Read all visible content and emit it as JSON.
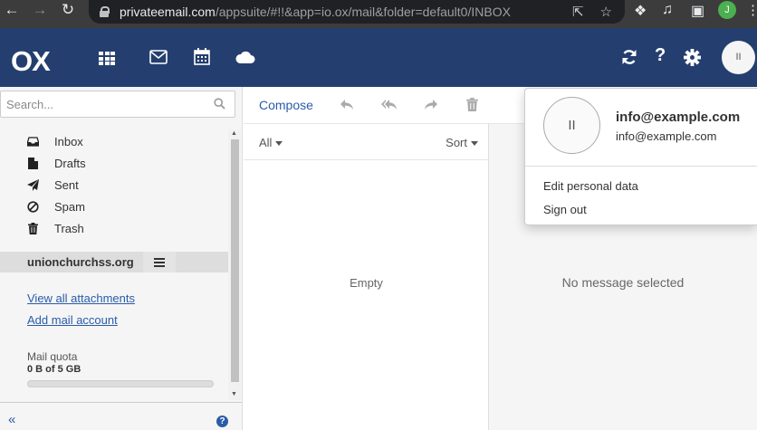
{
  "browser": {
    "url_host": "privateemail.com",
    "url_path": "/appsuite/#!!&app=io.ox/mail&folder=default0/INBOX",
    "profile_initial": "J"
  },
  "header": {
    "logo": "OX",
    "avatar_initials": "II"
  },
  "search": {
    "placeholder": "Search..."
  },
  "folders": [
    {
      "label": "Inbox",
      "icon": "inbox-icon"
    },
    {
      "label": "Drafts",
      "icon": "file-icon"
    },
    {
      "label": "Sent",
      "icon": "paper-plane-icon"
    },
    {
      "label": "Spam",
      "icon": "ban-icon"
    },
    {
      "label": "Trash",
      "icon": "trash-icon"
    }
  ],
  "account": {
    "name": "unionchurchss.org"
  },
  "links": {
    "view_attachments": "View all attachments",
    "add_account": "Add mail account"
  },
  "quota": {
    "label": "Mail quota",
    "value": "0 B of 5 GB",
    "fraction": 0.0
  },
  "toolbar": {
    "compose": "Compose"
  },
  "list": {
    "filter": "All",
    "sort": "Sort",
    "empty": "Empty"
  },
  "detail": {
    "placeholder": "No message selected"
  },
  "popover": {
    "avatar_initials": "II",
    "name": "info@example.com",
    "email": "info@example.com",
    "items": [
      "Edit personal data",
      "Sign out"
    ]
  },
  "colors": {
    "header_bg": "#243f6f",
    "link": "#2a5ca8",
    "chrome_bg": "#3c3c3c"
  }
}
